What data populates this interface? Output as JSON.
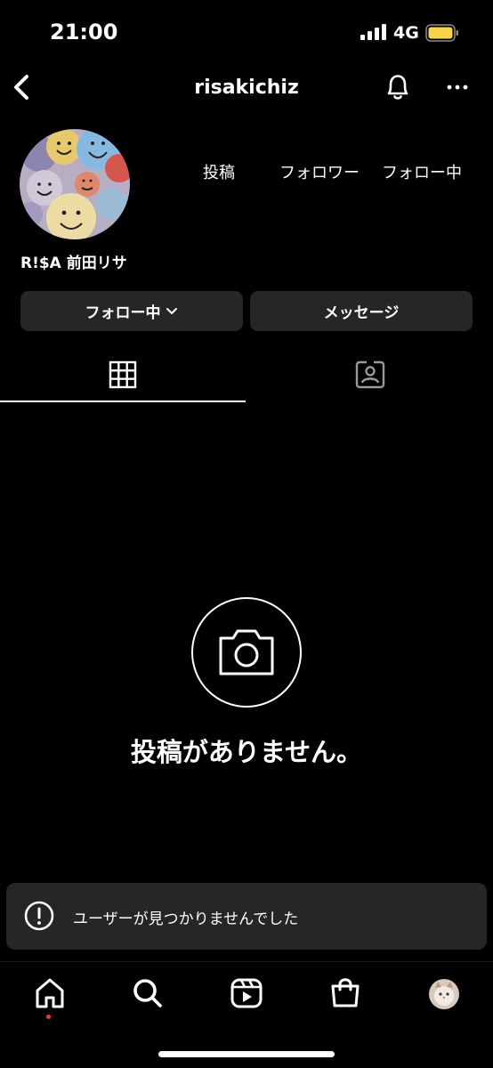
{
  "status_bar": {
    "time": "21:00",
    "network": "4G",
    "battery_color": "#f7d54a"
  },
  "header": {
    "username": "risakichiz"
  },
  "profile": {
    "stats": {
      "posts_label": "投稿",
      "followers_label": "フォロワー",
      "following_label": "フォロー中"
    },
    "display_name": "R!$A 前田リサ"
  },
  "buttons": {
    "following_label": "フォロー中",
    "message_label": "メッセージ"
  },
  "empty_state": {
    "message": "投稿がありません。"
  },
  "toast": {
    "message": "ユーザーが見つかりませんでした"
  },
  "bottom_nav": {
    "items": [
      "home-icon",
      "search-icon",
      "reels-icon",
      "shop-icon",
      "profile-avatar"
    ],
    "active_dot_color": "#ff3040"
  }
}
